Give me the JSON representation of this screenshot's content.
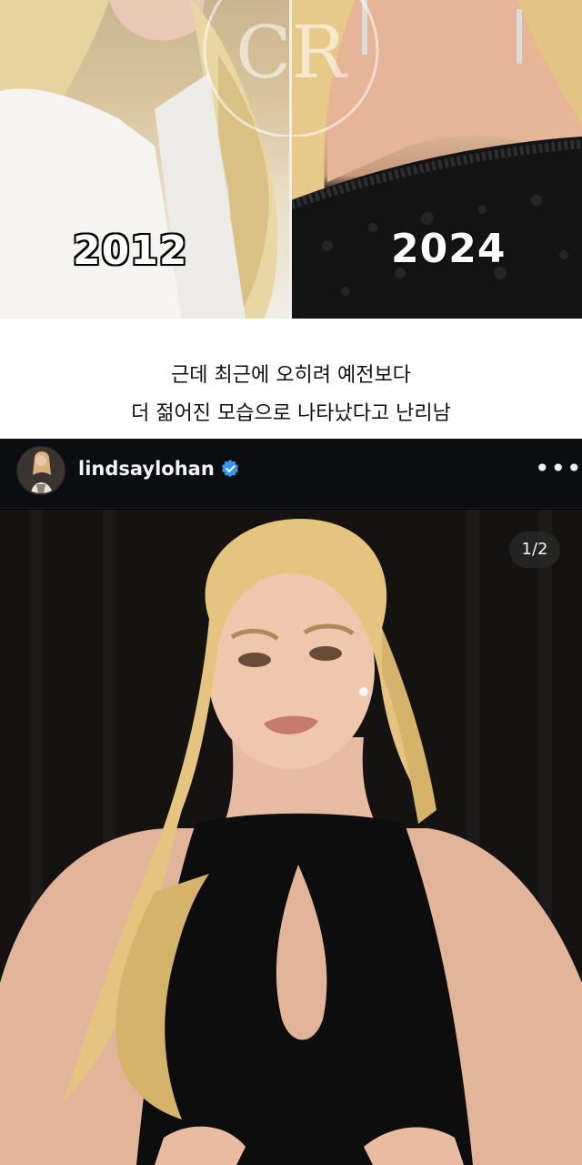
{
  "comparison": {
    "left_year": "2012",
    "right_year": "2024",
    "watermark": "CR"
  },
  "caption": {
    "line1": "근데 최근에 오히려 예전보다",
    "line2": "더 젊어진 모습으로 나타났다고 난리남"
  },
  "post": {
    "username": "lindsaylohan",
    "verified_icon": "verified-badge-icon",
    "more_icon": "more-options-icon",
    "more_label": "•••",
    "image_counter": "1/2",
    "colors": {
      "header_bg": "#0c0d10",
      "verified_blue": "#3897f0"
    }
  }
}
